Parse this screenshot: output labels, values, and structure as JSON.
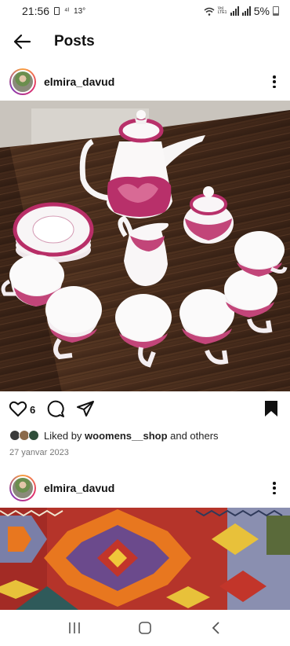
{
  "status_bar": {
    "time": "21:56",
    "temperature": "13°",
    "volte": "Vo) LTE1",
    "battery": "5%"
  },
  "header": {
    "title": "Posts"
  },
  "posts": [
    {
      "username": "elmira_davud",
      "image_alt": "Porcelain tea set with pink floral pattern on a wooden table",
      "like_count": "6",
      "liked_by_prefix": "Liked by ",
      "liked_by_user": "woomens__shop",
      "liked_by_suffix": " and others",
      "date": "27 yanvar 2023"
    },
    {
      "username": "elmira_davud",
      "image_alt": "Colorful woven kilim rug"
    }
  ],
  "colors": {
    "accent_story_ring": "#e1306c",
    "text": "#111111",
    "muted": "#777777"
  },
  "icons": {
    "back": "arrow-left-icon",
    "more": "more-vertical-icon",
    "like": "heart-icon",
    "comment": "comment-icon",
    "share": "send-icon",
    "save": "bookmark-icon",
    "nav_recents": "recents-icon",
    "nav_home": "home-icon",
    "nav_back": "back-chevron-icon"
  }
}
